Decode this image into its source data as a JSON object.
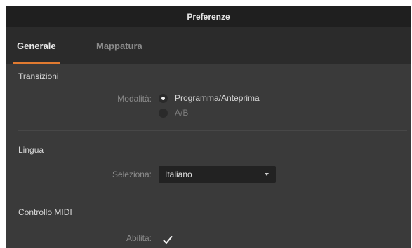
{
  "window": {
    "title": "Preferenze"
  },
  "tabs": [
    {
      "label": "Generale",
      "active": true
    },
    {
      "label": "Mappatura",
      "active": false
    }
  ],
  "transitions": {
    "title": "Transizioni",
    "mode_label": "Modalità:",
    "options": [
      {
        "label": "Programma/Anteprima",
        "selected": true
      },
      {
        "label": "A/B",
        "selected": false
      }
    ]
  },
  "language": {
    "title": "Lingua",
    "select_label": "Seleziona:",
    "selected": "Italiano"
  },
  "midi": {
    "title": "Controllo MIDI",
    "enable_label": "Abilita:",
    "enabled": true
  },
  "colors": {
    "accent": "#e07a30",
    "background": "#3a3a3a",
    "titlebar": "#1f1f1f"
  },
  "icons": {
    "dropdown": "chevron-down-icon",
    "check": "checkmark-icon"
  }
}
